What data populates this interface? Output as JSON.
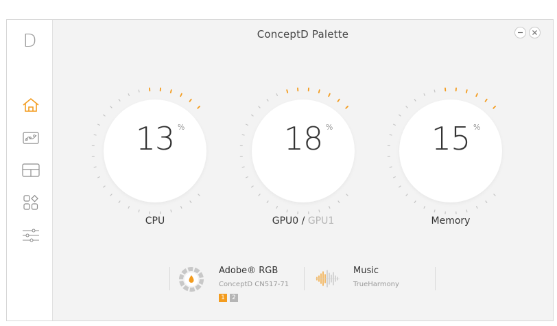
{
  "app": {
    "logo": "D",
    "title": "ConceptD Palette"
  },
  "sidebar": {
    "items": [
      {
        "name": "home",
        "icon": "home-icon",
        "active": true
      },
      {
        "name": "display",
        "icon": "color-graph-icon",
        "active": false
      },
      {
        "name": "layout",
        "icon": "layout-icon",
        "active": false
      },
      {
        "name": "apps",
        "icon": "apps-icon",
        "active": false
      },
      {
        "name": "settings",
        "icon": "sliders-icon",
        "active": false
      }
    ]
  },
  "gauges": [
    {
      "value": "13",
      "unit": "%",
      "label": "CPU",
      "percent": 13
    },
    {
      "value": "18",
      "unit": "%",
      "label_primary": "GPU0",
      "separator": " / ",
      "label_secondary": "GPU1",
      "percent": 18
    },
    {
      "value": "15",
      "unit": "%",
      "label": "Memory",
      "percent": 15
    }
  ],
  "color_profile": {
    "title": "Adobe® RGB",
    "subtitle": "ConceptD CN517-71",
    "displays": [
      "1",
      "2"
    ]
  },
  "audio_profile": {
    "title": "Music",
    "subtitle": "TrueHarmony"
  },
  "colors": {
    "accent": "#f39c1f",
    "tick_inactive": "#c4c4c4"
  }
}
